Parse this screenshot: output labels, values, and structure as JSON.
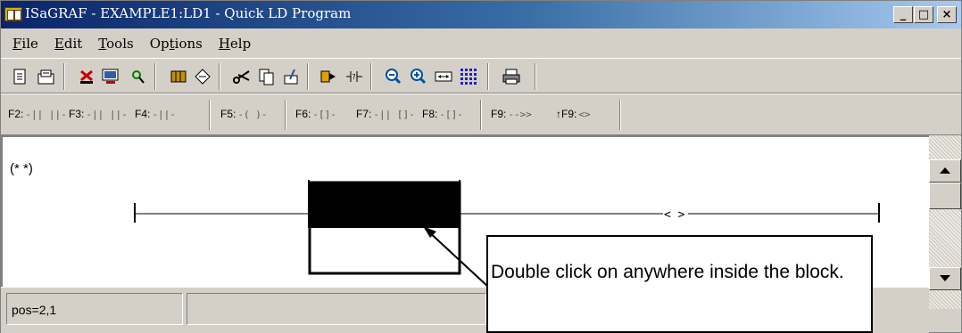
{
  "window": {
    "title": "ISaGRAF - EXAMPLE1:LD1 - Quick LD Program",
    "controls": {
      "minimize": "_",
      "maximize": "□",
      "close": "×"
    }
  },
  "menu": [
    {
      "label": "File",
      "mnemonic": "F",
      "rest": "ile"
    },
    {
      "label": "Edit",
      "mnemonic": "E",
      "rest": "dit"
    },
    {
      "label": "Tools",
      "mnemonic": "T",
      "rest": "ools"
    },
    {
      "label": "Options",
      "pre": "Op",
      "mnemonic": "t",
      "rest": "ions"
    },
    {
      "label": "Help",
      "mnemonic": "H",
      "rest": "elp"
    }
  ],
  "toolbar_main": {
    "icons": [
      "new-document-icon",
      "open-document-icon",
      "delete-icon",
      "monitor-icon",
      "find-icon",
      "library-icon",
      "navigate-icon",
      "cut-icon",
      "copy-icon",
      "paste-icon",
      "insert-icon",
      "contact-edit-icon",
      "zoom-out-icon",
      "zoom-in-icon",
      "fit-width-icon",
      "grid-icon",
      "print-icon"
    ]
  },
  "toolbar_fkeys": [
    {
      "key": "F2:",
      "icon": "-|| ||-"
    },
    {
      "key": "F3:",
      "icon": "-|| ||-"
    },
    {
      "key": "F4:",
      "icon": "-||-"
    },
    {
      "key": "F5:",
      "icon": "-( )-"
    },
    {
      "key": "F6:",
      "icon": "-[]-"
    },
    {
      "key": "F7:",
      "icon": "-|| []-"
    },
    {
      "key": "F8:",
      "icon": "-[]-"
    },
    {
      "key": "F9:",
      "icon": "-->>"
    },
    {
      "key": "↑F9:",
      "icon": "<>"
    }
  ],
  "editor": {
    "comment": "(* *)",
    "coil": "< >"
  },
  "statusbar": {
    "position": "pos=2,1"
  },
  "callout": {
    "text": "Double click on anywhere inside the block."
  }
}
